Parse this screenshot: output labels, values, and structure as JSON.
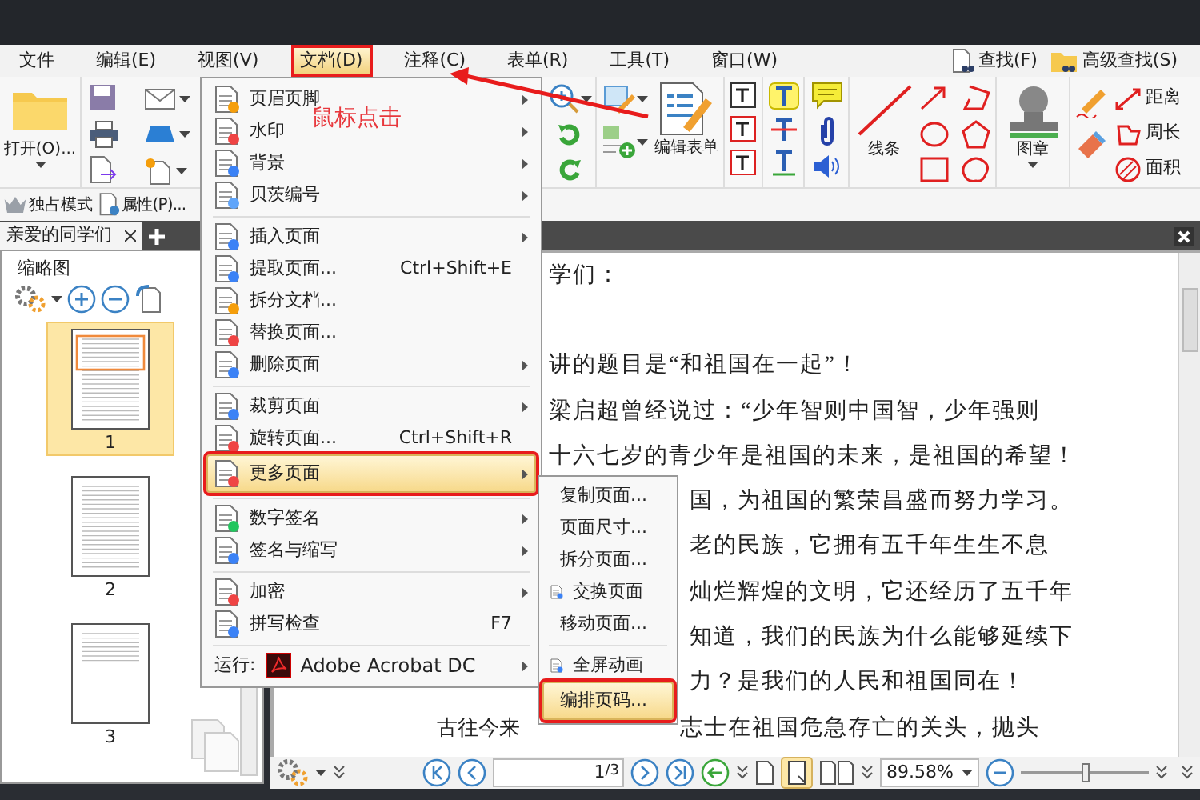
{
  "menu_bar": [
    {
      "label": "文件",
      "selected": false,
      "marked": false
    },
    {
      "label": "编辑(E)",
      "selected": false,
      "marked": false
    },
    {
      "label": "视图(V)",
      "selected": false,
      "marked": false
    },
    {
      "label": "文档(D)",
      "selected": true,
      "marked": true
    },
    {
      "label": "注释(C)",
      "selected": false,
      "marked": false
    },
    {
      "label": "表单(R)",
      "selected": false,
      "marked": false
    },
    {
      "label": "工具(T)",
      "selected": false,
      "marked": false
    },
    {
      "label": "窗口(W)",
      "selected": false,
      "marked": false
    }
  ],
  "search_buttons": [
    "查找(F)",
    "高级查找(S)"
  ],
  "ribbon": {
    "open": "打开(O)...",
    "edit_form": "编辑表单",
    "line": "线条",
    "stamp": "图章",
    "distance": "距离",
    "perimeter": "周长",
    "area": "面积"
  },
  "toolbar": [
    "独占模式",
    "属性(P)..."
  ],
  "tabs": [
    {
      "label": "亲爱的同学们",
      "selected": true
    }
  ],
  "thumbnails": {
    "title": "缩略图",
    "pages": [
      {
        "label": "1",
        "selected": true
      },
      {
        "label": "2",
        "selected": false
      },
      {
        "label": "3",
        "selected": false
      }
    ]
  },
  "document_lines": [
    "学们：",
    "讲的题目是“和祖国在一起”！",
    "梁启超曾经说过：“少年智则中国智，少年强则",
    "十六七岁的青少年是祖国的未来，是祖国的希望！",
    "国，为祖国的繁荣昌盛而努力学习。",
    "老的民族，它拥有五千年生生不息",
    "灿烂辉煌的文明，它还经历了五千年",
    "知道，我们的民族为什么能够延续下",
    "力？是我们的人民和祖国同在！",
    [
      "古往今来",
      "志士在祖国危急存亡的关头，抛头"
    ]
  ],
  "document_menu": [
    {
      "kind": "item",
      "label": "页眉页脚",
      "has_submenu": true,
      "highlighted": false,
      "marked": false
    },
    {
      "kind": "item",
      "label": "水印",
      "has_submenu": true,
      "highlighted": false,
      "marked": false
    },
    {
      "kind": "item",
      "label": "背景",
      "has_submenu": true,
      "highlighted": false,
      "marked": false
    },
    {
      "kind": "item",
      "label": "贝茨编号",
      "has_submenu": true,
      "highlighted": false,
      "marked": false
    },
    {
      "kind": "separator"
    },
    {
      "kind": "item",
      "label": "插入页面",
      "has_submenu": true,
      "highlighted": false,
      "marked": false
    },
    {
      "kind": "item",
      "label": "提取页面...",
      "shortcut": "Ctrl+Shift+E",
      "has_submenu": false,
      "highlighted": false,
      "marked": false
    },
    {
      "kind": "item",
      "label": "拆分文档...",
      "has_submenu": false,
      "highlighted": false,
      "marked": false
    },
    {
      "kind": "item",
      "label": "替换页面...",
      "has_submenu": false,
      "highlighted": false,
      "marked": false
    },
    {
      "kind": "item",
      "label": "删除页面",
      "has_submenu": true,
      "highlighted": false,
      "marked": false
    },
    {
      "kind": "separator"
    },
    {
      "kind": "item",
      "label": "裁剪页面",
      "has_submenu": true,
      "highlighted": false,
      "marked": false
    },
    {
      "kind": "item",
      "label": "旋转页面...",
      "shortcut": "Ctrl+Shift+R",
      "has_submenu": false,
      "highlighted": false,
      "marked": false
    },
    {
      "kind": "item",
      "label": "更多页面",
      "has_submenu": true,
      "highlighted": true,
      "marked": true,
      "children": [
        {
          "kind": "item",
          "label": "复制页面...",
          "highlighted": false,
          "marked": false
        },
        {
          "kind": "item",
          "label": "页面尺寸...",
          "highlighted": false,
          "marked": false
        },
        {
          "kind": "item",
          "label": "拆分页面...",
          "highlighted": false,
          "marked": false
        },
        {
          "kind": "item",
          "label": "交换页面",
          "highlighted": false,
          "marked": false
        },
        {
          "kind": "item",
          "label": "移动页面...",
          "highlighted": false,
          "marked": false
        },
        {
          "kind": "separator"
        },
        {
          "kind": "item",
          "label": "全屏动画",
          "highlighted": false,
          "marked": false
        },
        {
          "kind": "item",
          "label": "编排页码...",
          "highlighted": true,
          "marked": true
        }
      ]
    },
    {
      "kind": "separator"
    },
    {
      "kind": "item",
      "label": "数字签名",
      "has_submenu": true,
      "highlighted": false,
      "marked": false
    },
    {
      "kind": "item",
      "label": "签名与缩写",
      "has_submenu": true,
      "highlighted": false,
      "marked": false
    },
    {
      "kind": "separator"
    },
    {
      "kind": "item",
      "label": "加密",
      "has_submenu": true,
      "highlighted": false,
      "marked": false
    },
    {
      "kind": "item",
      "label": "拼写检查",
      "shortcut": "F7",
      "has_submenu": false,
      "highlighted": false,
      "marked": false
    },
    {
      "kind": "separator"
    },
    {
      "kind": "run",
      "label": "运行:",
      "app": "Adobe Acrobat DC",
      "has_submenu": true,
      "highlighted": false,
      "marked": false
    }
  ],
  "annotation": {
    "text": "鼠标点击"
  },
  "navigation": {
    "page": "1",
    "total": "/3",
    "zoom": "89.58%",
    "zoom_slider": {
      "level": 0.5
    }
  }
}
